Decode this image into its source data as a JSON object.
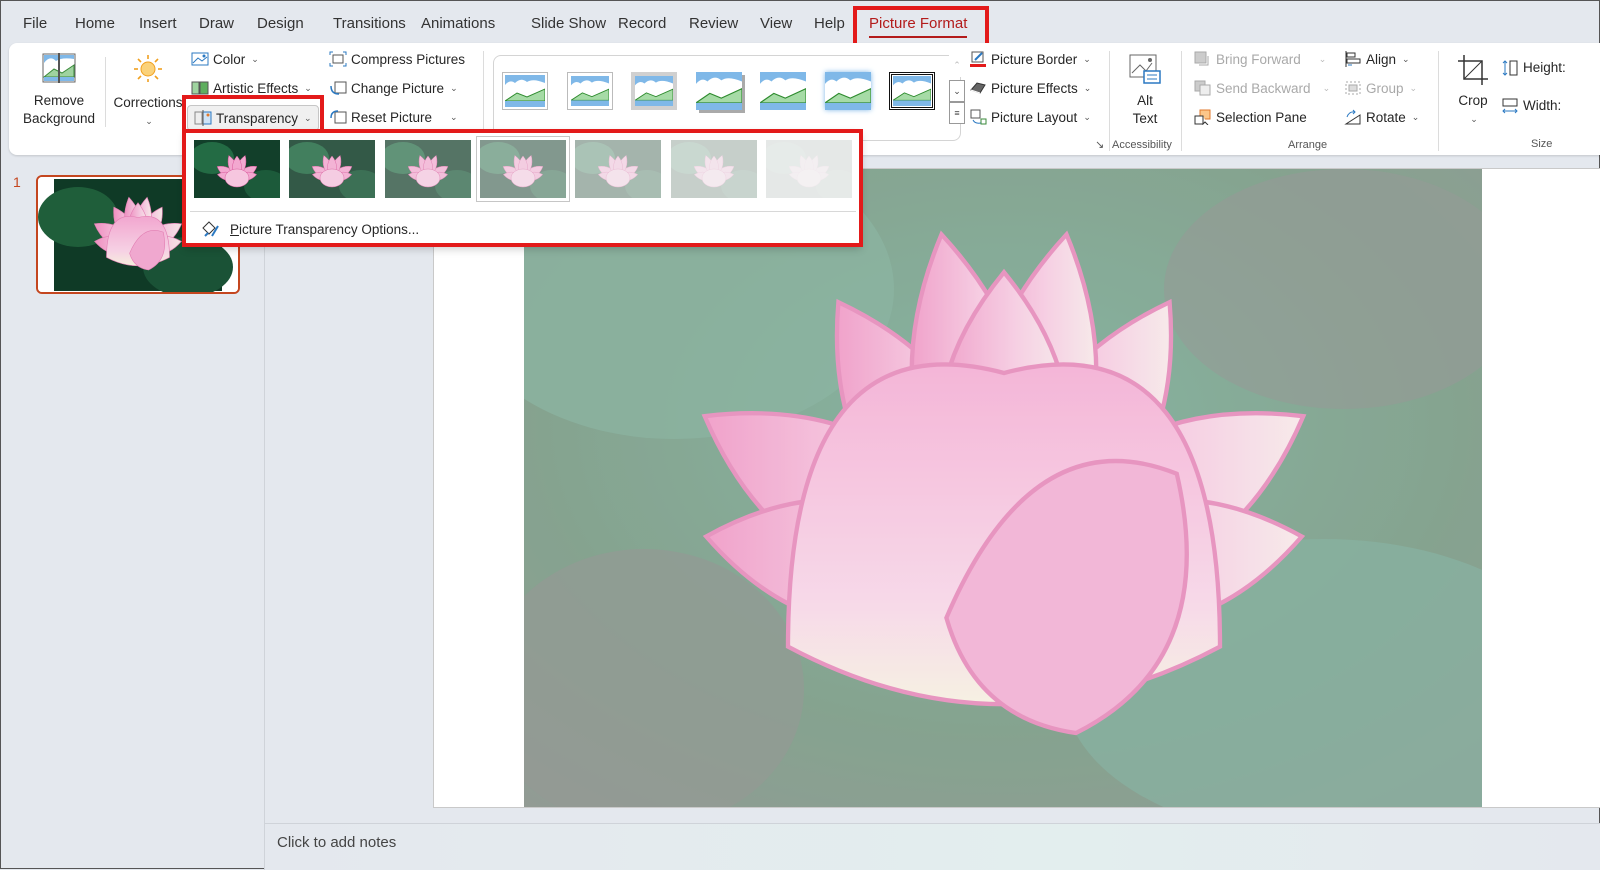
{
  "menu": {
    "tabs": [
      {
        "label": "File"
      },
      {
        "label": "Home"
      },
      {
        "label": "Insert"
      },
      {
        "label": "Draw"
      },
      {
        "label": "Design"
      },
      {
        "label": "Transitions"
      },
      {
        "label": "Animations"
      },
      {
        "label": "Slide Show"
      },
      {
        "label": "Record"
      },
      {
        "label": "Review"
      },
      {
        "label": "View"
      },
      {
        "label": "Help"
      },
      {
        "label": "Picture Format",
        "active": true
      }
    ]
  },
  "ribbon": {
    "adjust": {
      "remove_background": "Remove Background",
      "remove_background_l1": "Remove",
      "remove_background_l2": "Background",
      "corrections": "Corrections",
      "color": "Color",
      "artistic_effects": "Artistic Effects",
      "transparency": "Transparency",
      "compress_pictures": "Compress Pictures",
      "change_picture": "Change Picture",
      "reset_picture": "Reset Picture"
    },
    "picture_styles": {
      "gallery_count": 7,
      "picture_border": "Picture Border",
      "picture_effects": "Picture Effects",
      "picture_layout": "Picture Layout"
    },
    "accessibility": {
      "alt_text_l1": "Alt",
      "alt_text_l2": "Text",
      "group_label": "Accessibility"
    },
    "arrange": {
      "bring_forward": "Bring Forward",
      "send_backward": "Send Backward",
      "selection_pane": "Selection Pane",
      "align": "Align",
      "group": "Group",
      "rotate": "Rotate",
      "group_label": "Arrange"
    },
    "size": {
      "crop": "Crop",
      "height": "Height:",
      "width": "Width:",
      "group_label": "Size"
    }
  },
  "transparency_dropdown": {
    "presets": [
      {
        "transparency_percent": 0
      },
      {
        "transparency_percent": 15
      },
      {
        "transparency_percent": 30
      },
      {
        "transparency_percent": 50,
        "selected": true
      },
      {
        "transparency_percent": 65
      },
      {
        "transparency_percent": 80
      },
      {
        "transparency_percent": 95
      }
    ],
    "options_label": "Picture Transparency Options..."
  },
  "slides_panel": {
    "slides": [
      {
        "number": "1",
        "selected": true
      }
    ]
  },
  "slide": {
    "picture_transparency_percent": 50
  },
  "notes": {
    "placeholder": "Click to add notes"
  },
  "colors": {
    "accent": "#b31b1b",
    "highlight": "#e31a1a",
    "thumb_border": "#c4461f"
  }
}
